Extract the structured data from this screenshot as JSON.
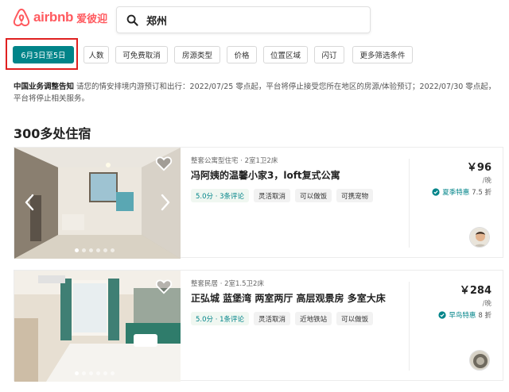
{
  "brand": {
    "name": "airbnb",
    "cn_name": "爱彼迎",
    "color": "#ff5a5f"
  },
  "search": {
    "value": "郑州"
  },
  "filters": [
    {
      "label": "6月3日至5日",
      "active": true
    },
    {
      "label": "人数"
    },
    {
      "label": "可免费取消"
    },
    {
      "label": "房源类型"
    },
    {
      "label": "价格"
    },
    {
      "label": "位置区域"
    },
    {
      "label": "闪订"
    },
    {
      "label": "更多筛选条件"
    }
  ],
  "notice": {
    "title": "中国业务调整告知",
    "body": "请您的情安排境内游预订和出行：2022/07/25 零点起，平台将停止接受您所在地区的房源/体验预订；2022/07/30 零点起，平台将停止相关服务。"
  },
  "section_title": "300多处住宿",
  "listings": [
    {
      "meta": "整套公寓型住宅 · 2室1卫2床",
      "title": "冯阿姨的温馨小家3，loft复式公寓",
      "rating": "5.0分 · 3条评论",
      "tags": [
        "灵活取消",
        "可以做饭",
        "可携宠物"
      ],
      "price": "￥96",
      "per": "/晚",
      "promo_name": "夏季特惠",
      "promo_discount": "7.5 折"
    },
    {
      "meta": "整套民居 · 2室1.5卫2床",
      "title": "正弘城 蓝堡湾 两室两厅 高层观景房 多室大床",
      "rating": "5.0分 · 1条评论",
      "tags": [
        "灵活取消",
        "近地铁站",
        "可以做饭"
      ],
      "price": "￥284",
      "per": "/晚",
      "promo_name": "早鸟特惠",
      "promo_discount": "8 折"
    }
  ],
  "colors": {
    "accent": "#008489",
    "highlight_border": "#e02020"
  }
}
